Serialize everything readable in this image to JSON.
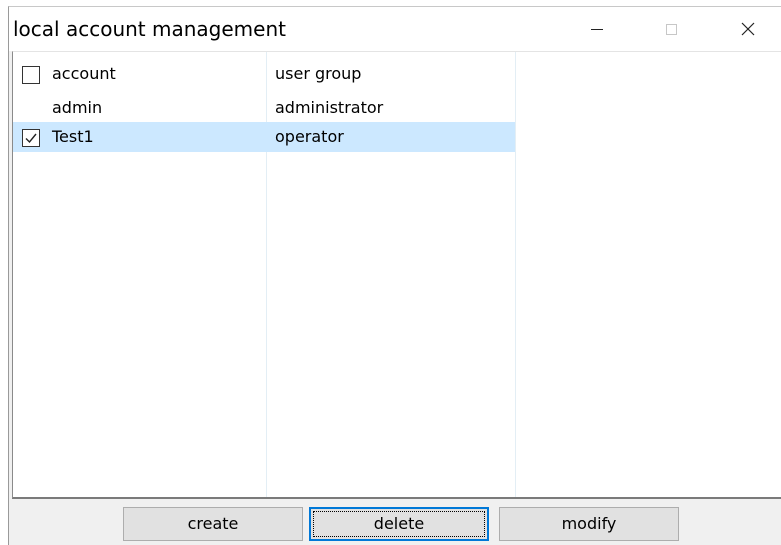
{
  "window": {
    "title": "local account management"
  },
  "titlebar": {
    "minimize_icon": "minimize-icon",
    "maximize_icon": "maximize-icon",
    "close_icon": "close-icon"
  },
  "table": {
    "header": {
      "account": "account",
      "user_group": "user group",
      "select_all_checked": false
    },
    "rows": [
      {
        "account": "admin",
        "user_group": "administrator",
        "has_checkbox": false,
        "checked": false,
        "selected": false
      },
      {
        "account": "Test1",
        "user_group": "operator",
        "has_checkbox": true,
        "checked": true,
        "selected": true
      }
    ]
  },
  "buttons": {
    "create": "create",
    "delete": "delete",
    "modify": "modify"
  },
  "colors": {
    "selection": "#cce8ff",
    "focus_border": "#0078d7",
    "button_face": "#e1e1e1",
    "window_bg": "#f0f0f0"
  }
}
